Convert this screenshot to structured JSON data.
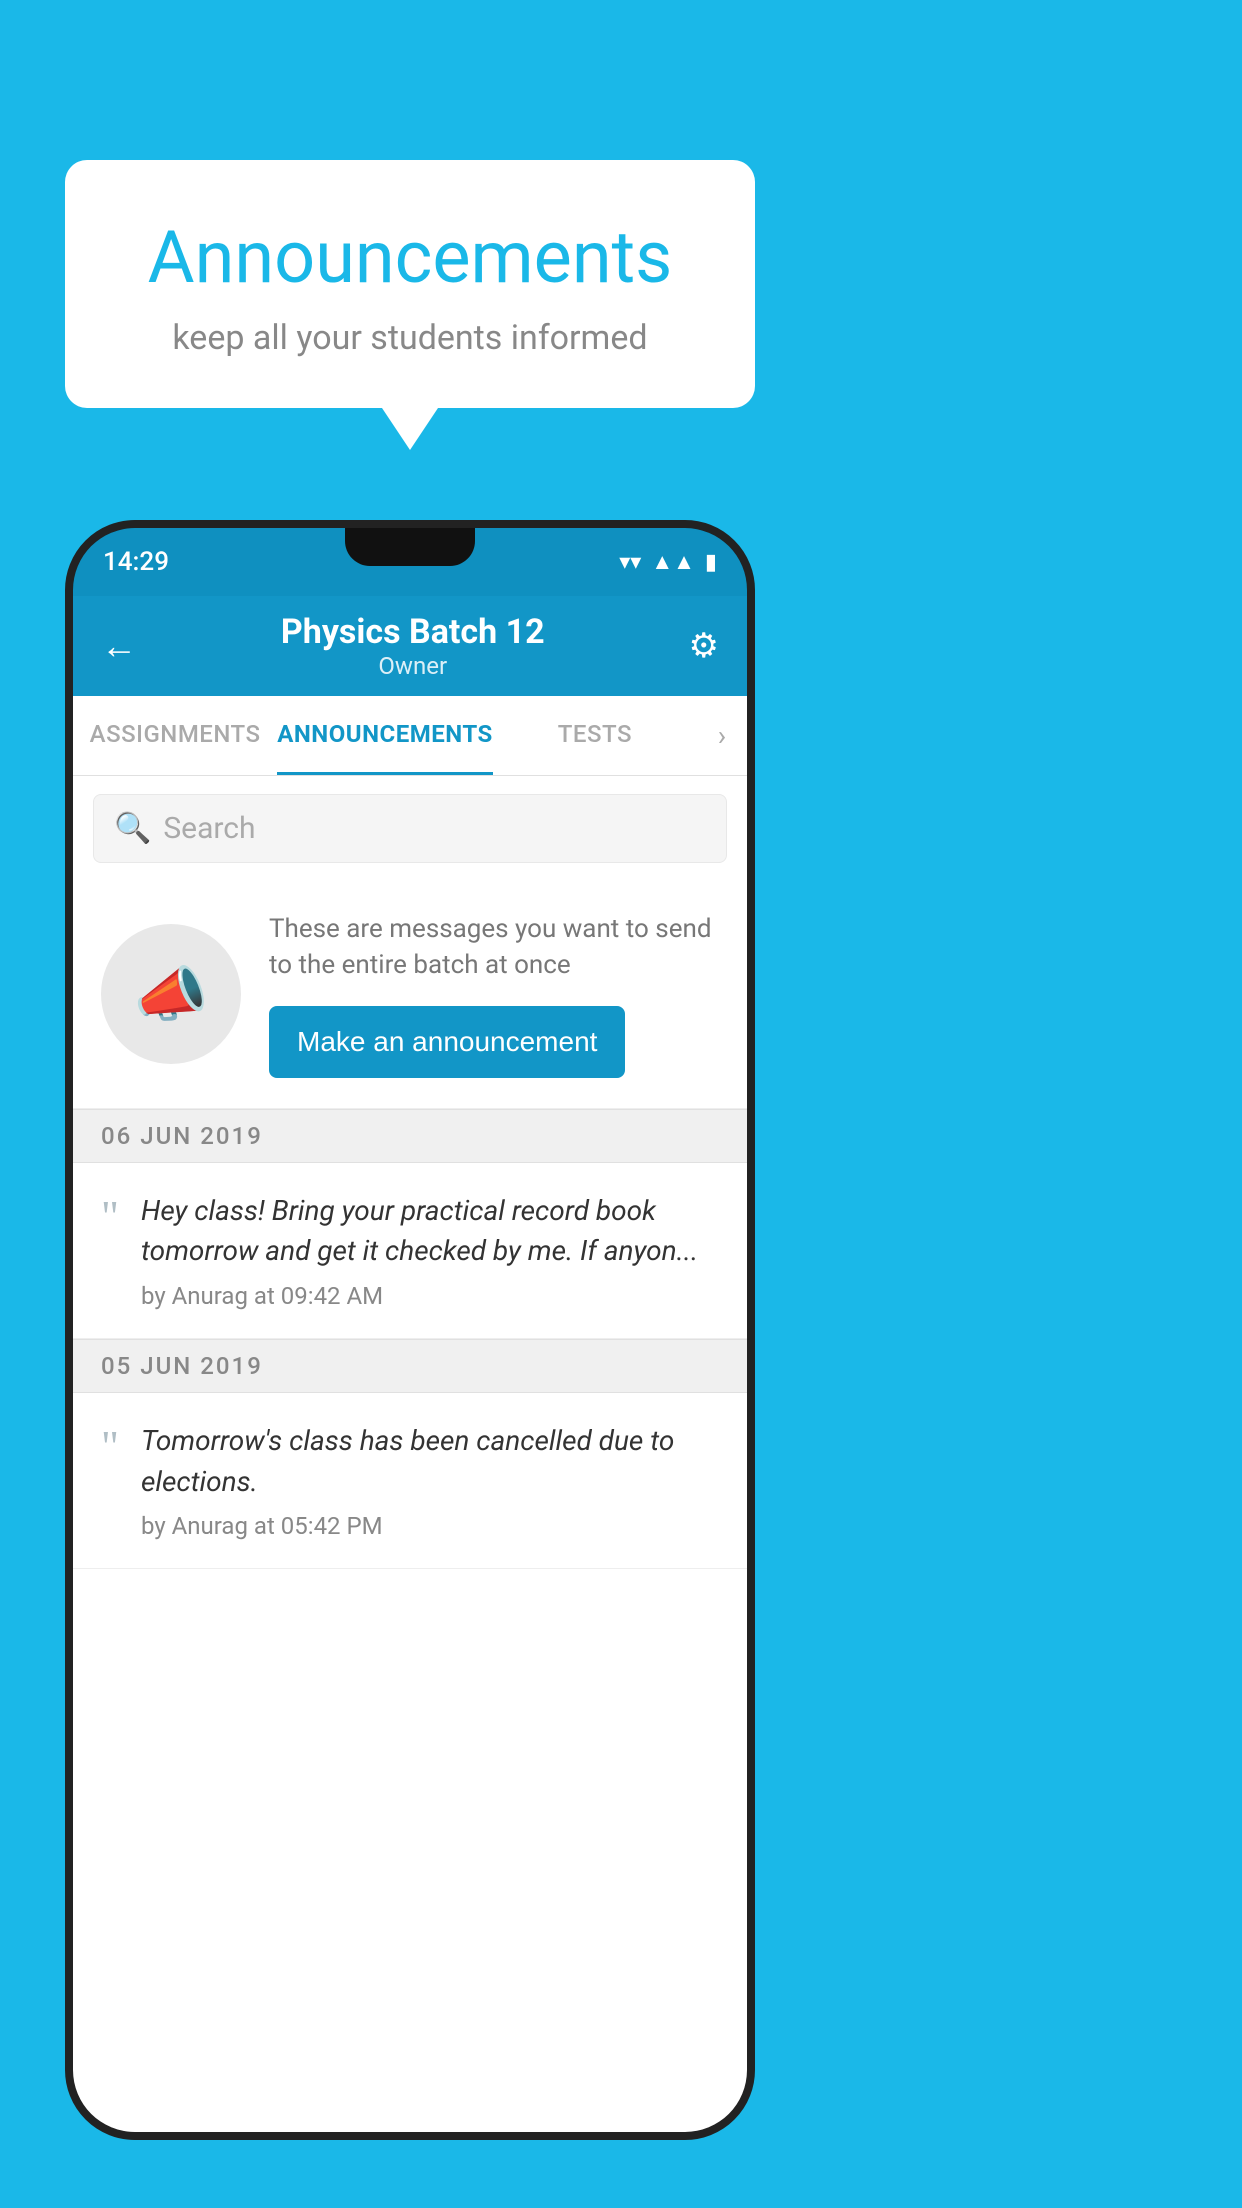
{
  "background_color": "#1ab8e8",
  "speech_bubble": {
    "title": "Announcements",
    "subtitle": "keep all your students informed"
  },
  "phone": {
    "status_bar": {
      "time": "14:29",
      "wifi_icon": "wifi",
      "signal_icon": "signal",
      "battery_icon": "battery"
    },
    "header": {
      "title": "Physics Batch 12",
      "subtitle": "Owner",
      "back_label": "←",
      "gear_label": "⚙"
    },
    "tabs": [
      {
        "label": "ASSIGNMENTS",
        "active": false
      },
      {
        "label": "ANNOUNCEMENTS",
        "active": true
      },
      {
        "label": "TESTS",
        "active": false
      }
    ],
    "search": {
      "placeholder": "Search"
    },
    "promo": {
      "description": "These are messages you want to send to the entire batch at once",
      "button_label": "Make an announcement"
    },
    "announcement_groups": [
      {
        "date": "06  JUN  2019",
        "items": [
          {
            "text": "Hey class! Bring your practical record book tomorrow and get it checked by me. If anyon...",
            "meta": "by Anurag at 09:42 AM"
          }
        ]
      },
      {
        "date": "05  JUN  2019",
        "items": [
          {
            "text": "Tomorrow's class has been cancelled due to elections.",
            "meta": "by Anurag at 05:42 PM"
          }
        ]
      }
    ]
  }
}
